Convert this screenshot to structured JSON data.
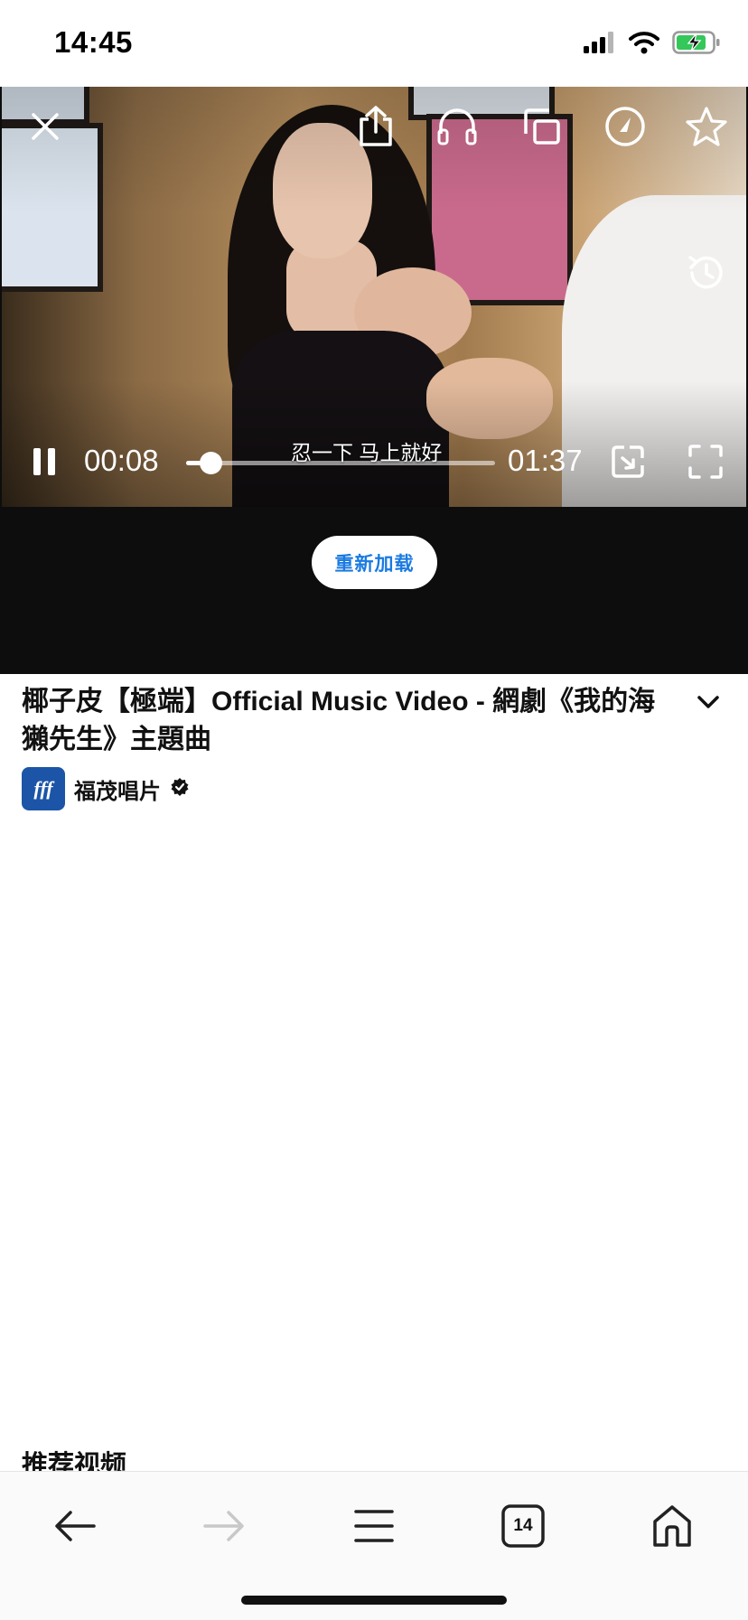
{
  "status_bar": {
    "time": "14:45",
    "icons": [
      "cellular-signal-icon",
      "wifi-icon",
      "battery-charging-icon"
    ]
  },
  "video": {
    "current_time": "00:08",
    "duration": "01:37",
    "progress_fraction": 0.08,
    "subtitle": "忍一下 马上就好",
    "top_controls": [
      "close-icon",
      "share-icon",
      "headphones-icon",
      "pip-icon",
      "speed-icon",
      "star-icon"
    ],
    "side_controls": [
      "history-icon"
    ],
    "bottom_controls": [
      "pause-icon",
      "resize-icon",
      "fullscreen-icon"
    ],
    "reload_label": "重新加载"
  },
  "info": {
    "title": "椰子皮【極端】Official Music Video - 網劇《我的海獺先生》主題曲",
    "channel_name": "福茂唱片",
    "channel_avatar_text": "fff",
    "verified": true
  },
  "recommendations": {
    "heading": "推荐视频"
  },
  "toolbar": {
    "tab_count": "14",
    "items": [
      "back-arrow-icon",
      "forward-arrow-icon",
      "menu-icon",
      "tabs-icon",
      "home-icon"
    ]
  },
  "colors": {
    "accent": "#1a7ae0",
    "video_bg": "#0d0d0d",
    "avatar_bg": "#1c55a7"
  }
}
